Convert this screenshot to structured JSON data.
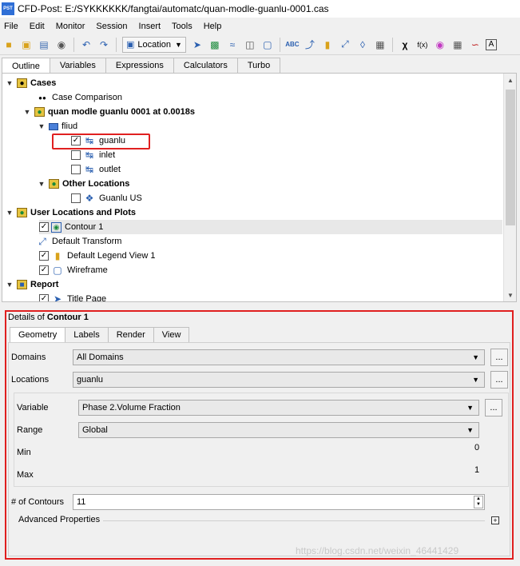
{
  "window": {
    "app_icon": "PST",
    "title": "CFD-Post: E:/SYKKKKKK/fangtai/automatc/quan-modle-guanlu-0001.cas"
  },
  "menu": [
    "File",
    "Edit",
    "Monitor",
    "Session",
    "Insert",
    "Tools",
    "Help"
  ],
  "toolbar": {
    "location_label": "Location"
  },
  "tabs": [
    "Outline",
    "Variables",
    "Expressions",
    "Calculators",
    "Turbo"
  ],
  "tree": {
    "cases": "Cases",
    "case_comparison": "Case Comparison",
    "case_name": "quan modle guanlu 0001 at 0.0018s",
    "domain": "fliud",
    "guanlu": "guanlu",
    "inlet": "inlet",
    "outlet": "outlet",
    "other_locations": "Other Locations",
    "guanlu_us": "Guanlu US",
    "user_locations": "User Locations and Plots",
    "contour": "Contour 1",
    "default_transform": "Default Transform",
    "legend": "Default Legend View 1",
    "wireframe": "Wireframe",
    "report": "Report",
    "title_page": "Title Page"
  },
  "details": {
    "title_prefix": "Details of",
    "title_object": "Contour 1",
    "tabs": [
      "Geometry",
      "Labels",
      "Render",
      "View"
    ],
    "domains_label": "Domains",
    "domains_value": "All Domains",
    "locations_label": "Locations",
    "locations_value": "guanlu",
    "variable_label": "Variable",
    "variable_value": "Phase 2.Volume Fraction",
    "range_label": "Range",
    "range_value": "Global",
    "min_label": "Min",
    "min_value": "0",
    "max_label": "Max",
    "max_value": "1",
    "contours_label": "# of Contours",
    "contours_value": "11",
    "advanced_label": "Advanced Properties",
    "dots": "..."
  },
  "watermark": "https://blog.csdn.net/weixin_46441429"
}
